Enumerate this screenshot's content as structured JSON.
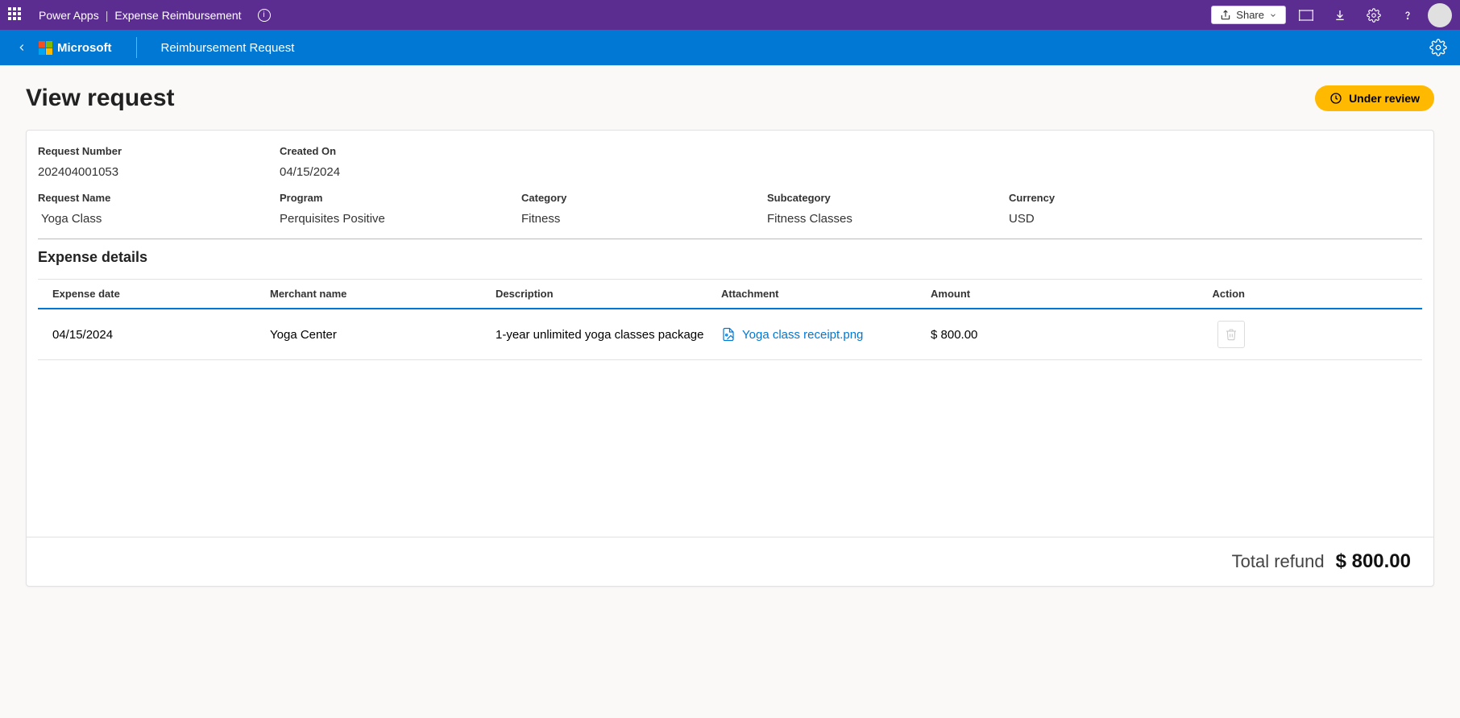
{
  "topbar": {
    "product": "Power Apps",
    "separator": "|",
    "app_name": "Expense Reimbursement",
    "share_label": "Share"
  },
  "bluebar": {
    "brand": "Microsoft",
    "app_title": "Reimbursement Request"
  },
  "page": {
    "title": "View request",
    "status": "Under review"
  },
  "meta": {
    "request_number_label": "Request Number",
    "request_number": "202404001053",
    "created_on_label": "Created On",
    "created_on": "04/15/2024",
    "request_name_label": "Request Name",
    "request_name": "Yoga Class",
    "program_label": "Program",
    "program": "Perquisites Positive",
    "category_label": "Category",
    "category": "Fitness",
    "subcategory_label": "Subcategory",
    "subcategory": "Fitness Classes",
    "currency_label": "Currency",
    "currency": "USD"
  },
  "section": {
    "expense_details_title": "Expense details"
  },
  "columns": {
    "expense_date": "Expense date",
    "merchant": "Merchant name",
    "description": "Description",
    "attachment": "Attachment",
    "amount": "Amount",
    "action": "Action"
  },
  "rows": [
    {
      "date": "04/15/2024",
      "merchant": "Yoga Center",
      "description": "1-year unlimited yoga classes package",
      "attachment": "Yoga class receipt.png",
      "amount": "$ 800.00"
    }
  ],
  "totals": {
    "label": "Total refund",
    "value": "$ 800.00"
  }
}
